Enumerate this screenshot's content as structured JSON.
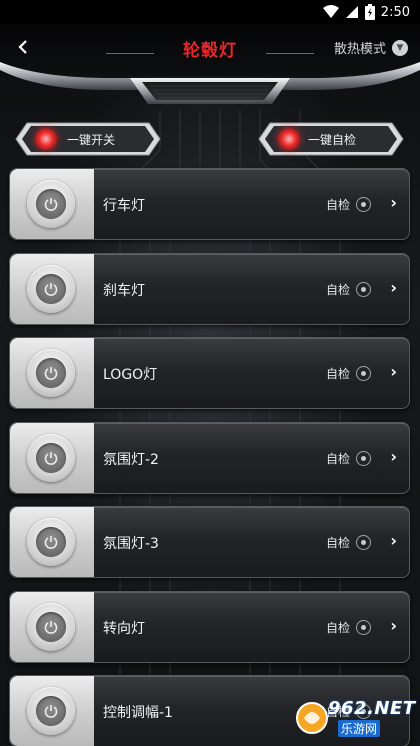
{
  "status_bar": {
    "time": "2:50",
    "icons": [
      "wifi-icon",
      "signal-icon",
      "battery-icon"
    ]
  },
  "header": {
    "title": "轮毂灯",
    "cooling_mode_label": "散热模式",
    "back_icon": "chevron-left-icon"
  },
  "quick_actions": {
    "all_on_label": "一键开关",
    "all_check_label": "一键自检"
  },
  "lights": [
    {
      "name": "行车灯",
      "check_label": "自检"
    },
    {
      "name": "刹车灯",
      "check_label": "自检"
    },
    {
      "name": "LOGO灯",
      "check_label": "自检"
    },
    {
      "name": "氛围灯-2",
      "check_label": "自检"
    },
    {
      "name": "氛围灯-3",
      "check_label": "自检"
    },
    {
      "name": "转向灯",
      "check_label": "自检"
    },
    {
      "name": "控制调幅-1",
      "check_label": "自检"
    }
  ],
  "watermark": {
    "brand": "962.NET",
    "subtitle": "乐游网"
  },
  "colors": {
    "title_red": "#e8272b",
    "accent_blue": "#2e78c4",
    "card_dark": "#232427",
    "panel_light": "#cfcfcf"
  }
}
